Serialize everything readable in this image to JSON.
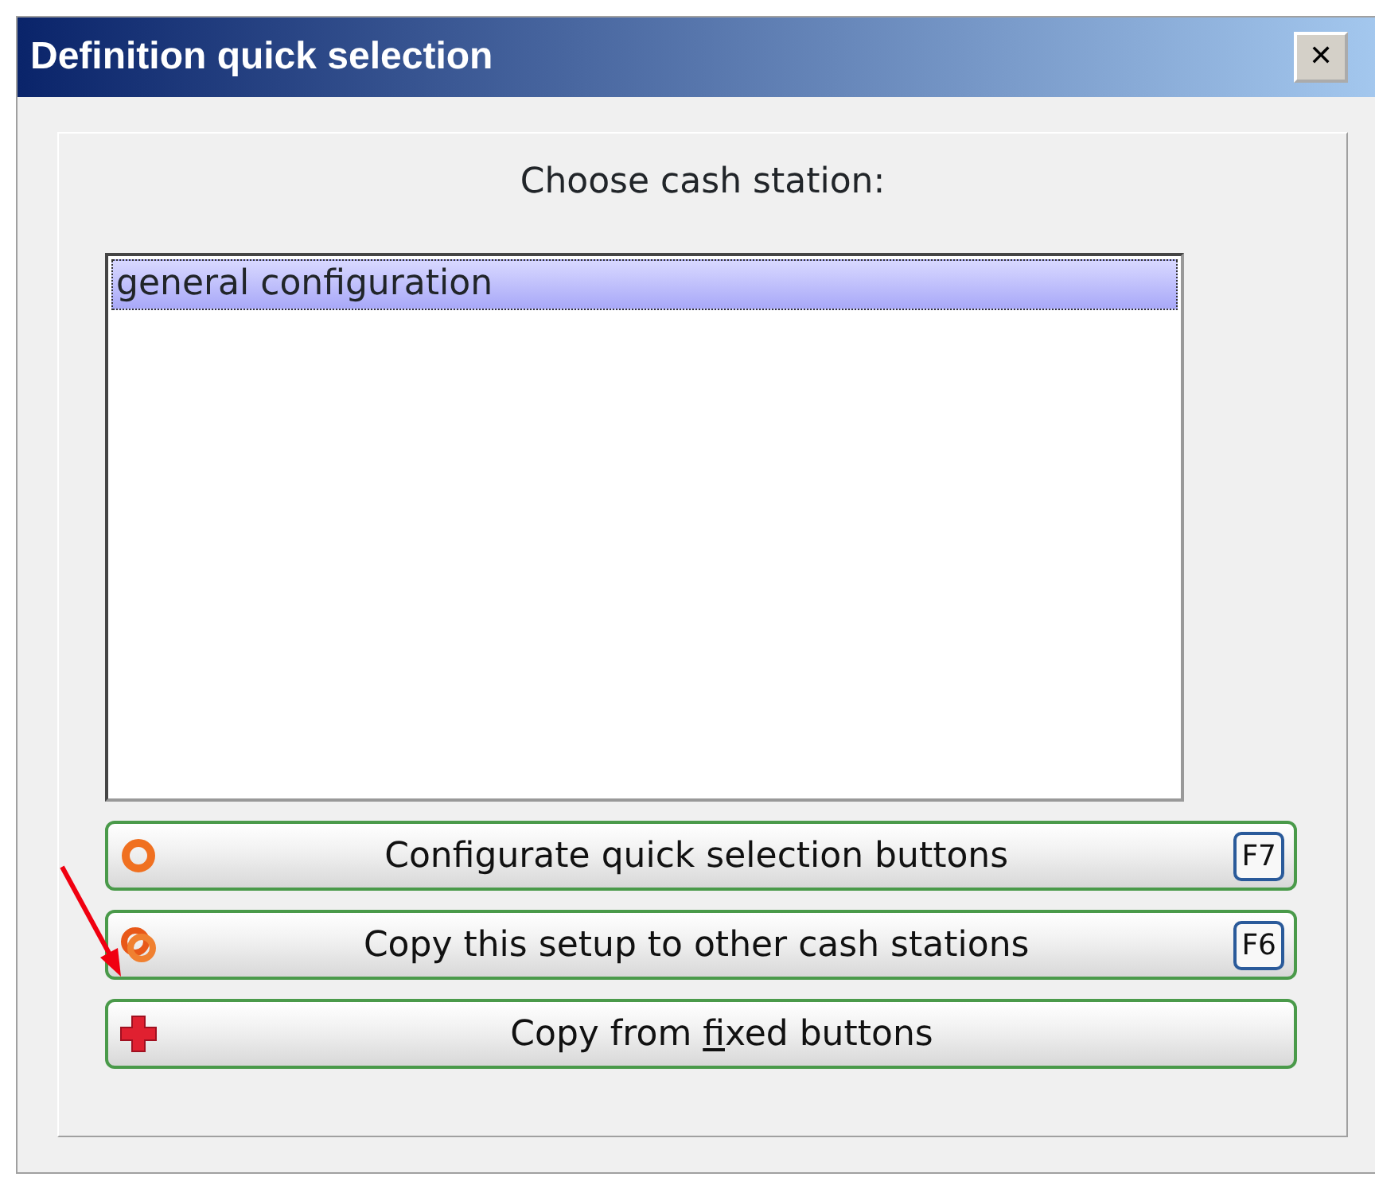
{
  "window": {
    "title": "Definition quick selection",
    "close": "✕"
  },
  "prompt": "Choose cash station:",
  "list": {
    "items": [
      {
        "label": "general configuration",
        "selected": true
      }
    ]
  },
  "buttons": [
    {
      "kind": "ring",
      "parts": [
        {
          "text": "Configurate quick selection buttons",
          "underlined": false
        }
      ],
      "shortcut": "F7"
    },
    {
      "kind": "double-ring",
      "parts": [
        {
          "text": "Copy this setup to other cash stations",
          "underlined": false
        }
      ],
      "shortcut": "F6"
    },
    {
      "kind": "cross",
      "parts": [
        {
          "text": "Copy from ",
          "underlined": false
        },
        {
          "text": "f",
          "underlined": true
        },
        {
          "text": "ixed buttons",
          "underlined": false
        }
      ]
    }
  ],
  "annotation": {
    "kind": "arrow"
  }
}
